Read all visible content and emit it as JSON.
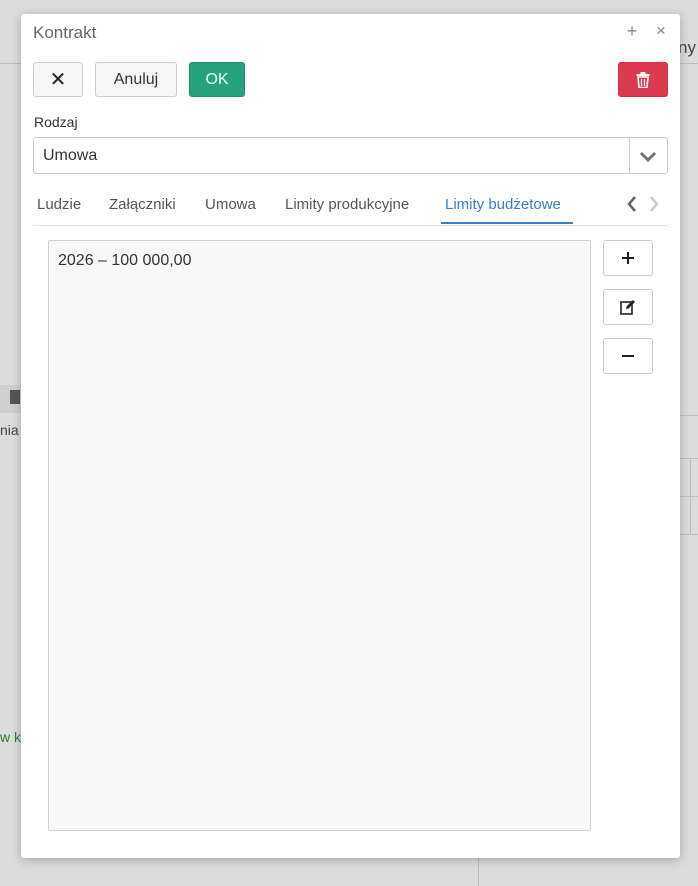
{
  "background": {
    "fragment_ny": "ny",
    "fragment_nia": "nia",
    "fragment_wkt": "w kt"
  },
  "dialog": {
    "title": "Kontrakt",
    "plus_icon": "+",
    "close_icon": "×"
  },
  "toolbar": {
    "close_label": "✕",
    "cancel_label": "Anuluj",
    "ok_label": "OK",
    "delete_icon": "trash-icon"
  },
  "form": {
    "type_label": "Rodzaj",
    "type_value": "Umowa"
  },
  "tabs": [
    {
      "label": "Ludzie"
    },
    {
      "label": "Załączniki"
    },
    {
      "label": "Umowa"
    },
    {
      "label": "Limity produkcyjne"
    },
    {
      "label": "Limity budżetowe",
      "active": true
    }
  ],
  "list": {
    "items": [
      "2026 – 100 000,00"
    ]
  },
  "side_actions": {
    "add": "+",
    "edit": "edit-icon",
    "remove": "−"
  },
  "colors": {
    "ok": "#26a27e",
    "delete": "#dc3b4f",
    "active_tab": "#3a7bd5"
  }
}
